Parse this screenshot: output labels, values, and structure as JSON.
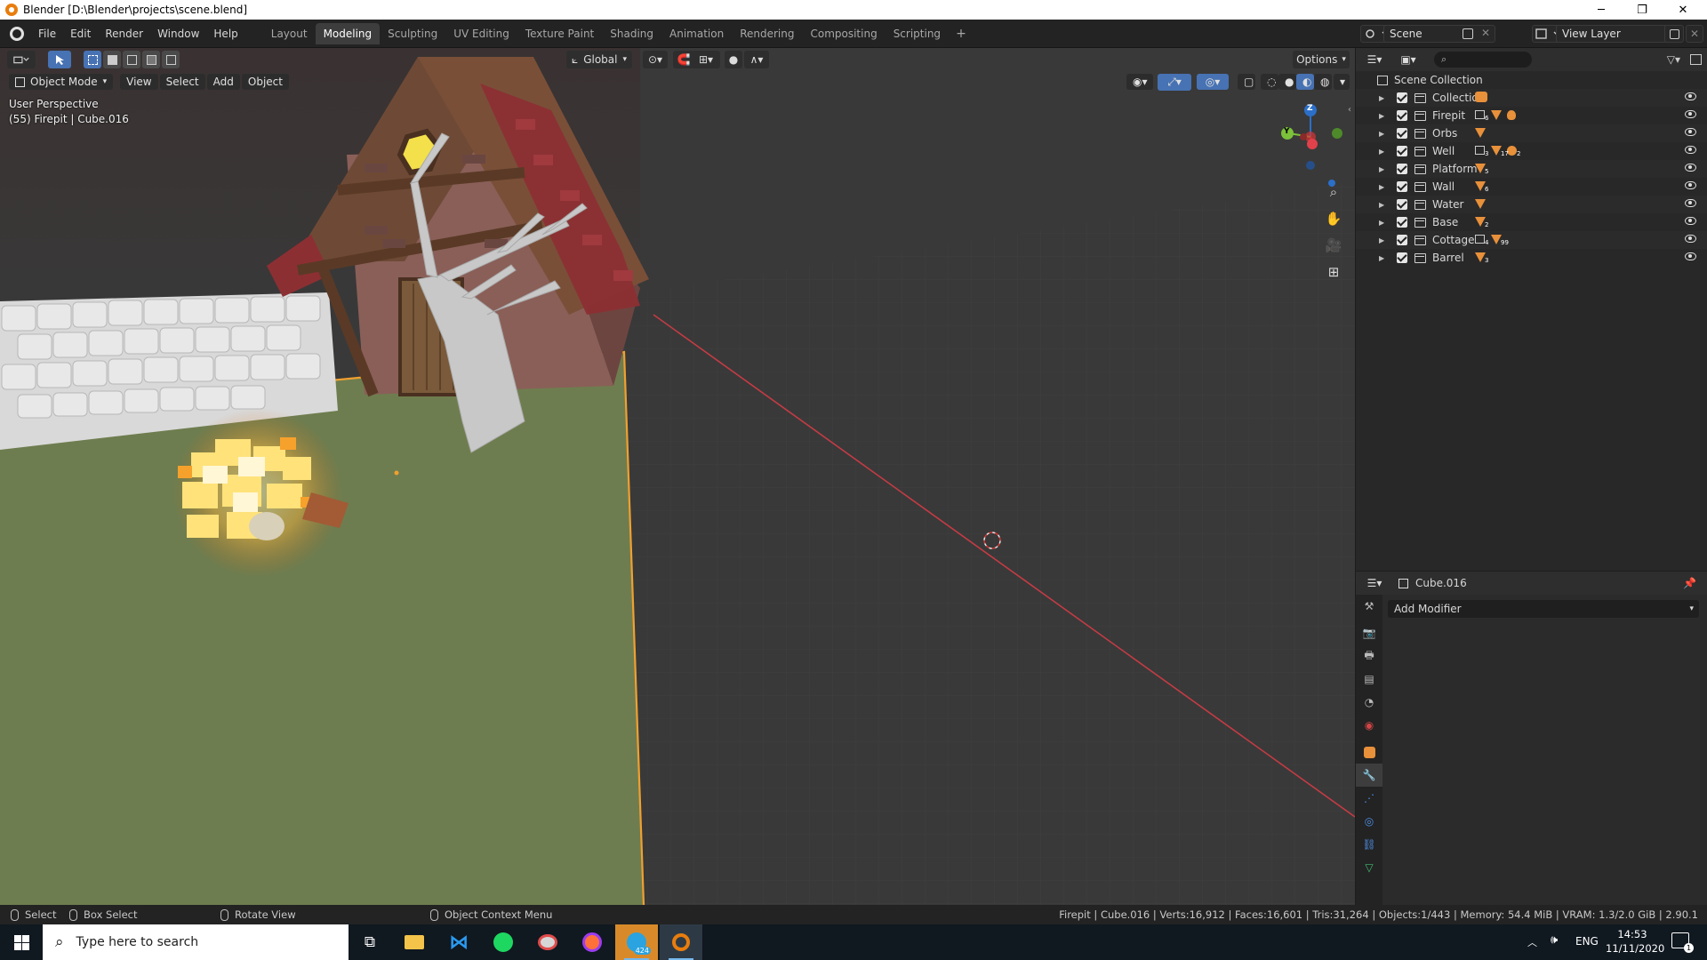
{
  "window": {
    "title": "Blender [D:\\Blender\\projects\\scene.blend]",
    "minimize": "─",
    "maximize": "❐",
    "close": "✕"
  },
  "menu": [
    "File",
    "Edit",
    "Render",
    "Window",
    "Help"
  ],
  "workspaces": [
    "Layout",
    "Modeling",
    "Sculpting",
    "UV Editing",
    "Texture Paint",
    "Shading",
    "Animation",
    "Rendering",
    "Compositing",
    "Scripting"
  ],
  "active_workspace": "Modeling",
  "workspace_add": "+",
  "scene": {
    "name": "Scene",
    "view_layer": "View Layer"
  },
  "viewport": {
    "orientation": "Global",
    "options_label": "Options",
    "mode": "Object Mode",
    "menus": [
      "View",
      "Select",
      "Add",
      "Object"
    ],
    "perspective": "User Perspective",
    "active_info": "(55) Firepit | Cube.016",
    "gizmo_z": "Z",
    "gizmo_y": "Y"
  },
  "outliner": {
    "root": "Scene Collection",
    "collections": [
      {
        "name": "Collection",
        "icons": [
          "camera-light-icon"
        ]
      },
      {
        "name": "Firepit",
        "icons": [
          "collection-icon",
          "mesh-icon",
          "light-icon"
        ],
        "badges": [
          "6"
        ]
      },
      {
        "name": "Orbs",
        "icons": [
          "mesh-icon"
        ]
      },
      {
        "name": "Well",
        "icons": [
          "collection-icon",
          "mesh-icon",
          "material-icon"
        ],
        "badges": [
          "3",
          "17",
          "2"
        ]
      },
      {
        "name": "Platform",
        "icons": [
          "mesh-icon"
        ],
        "badges": [
          "5"
        ]
      },
      {
        "name": "Wall",
        "icons": [
          "mesh-icon"
        ],
        "badges": [
          "6"
        ]
      },
      {
        "name": "Water",
        "icons": [
          "mesh-icon"
        ]
      },
      {
        "name": "Base",
        "icons": [
          "mesh-icon"
        ],
        "badges": [
          "2"
        ]
      },
      {
        "name": "Cottage",
        "icons": [
          "collection-icon",
          "mesh-icon"
        ],
        "badges": [
          "4",
          "99"
        ]
      },
      {
        "name": "Barrel",
        "icons": [
          "mesh-icon"
        ],
        "badges": [
          "3"
        ]
      }
    ]
  },
  "properties": {
    "object": "Cube.016",
    "add_modifier": "Add Modifier"
  },
  "statusbar": {
    "select": "Select",
    "box_select": "Box Select",
    "rotate": "Rotate View",
    "context_menu": "Object Context Menu",
    "stats": "Firepit | Cube.016 | Verts:16,912 | Faces:16,601 | Tris:31,264 | Objects:1/443 | Memory: 54.4 MiB | VRAM: 1.3/2.0 GiB | 2.90.1"
  },
  "taskbar": {
    "search_placeholder": "Type here to search",
    "telegram_badge": "424",
    "language": "ENG",
    "time": "14:53",
    "date": "11/11/2020",
    "notif_count": "1"
  },
  "colors": {
    "accent": "#4772b3",
    "selection": "#f0a030",
    "red_axis": "#c43b44",
    "ground": "#6e7d4f"
  }
}
